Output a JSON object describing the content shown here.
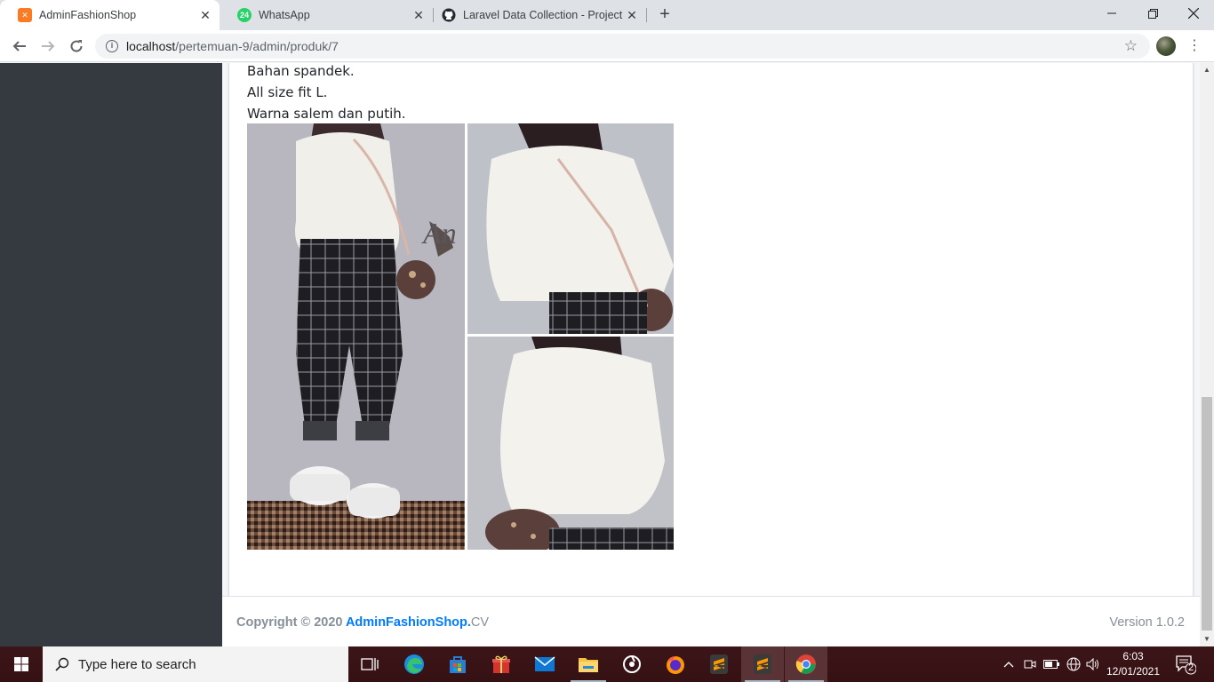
{
  "browser": {
    "tabs": [
      {
        "title": "AdminFashionShop",
        "active": true,
        "favicon": "xampp-icon"
      },
      {
        "title": "WhatsApp",
        "active": false,
        "favicon": "whatsapp-icon",
        "badge": "24"
      },
      {
        "title": "Laravel Data Collection - Project",
        "active": false,
        "favicon": "github-icon"
      }
    ],
    "new_tab_label": "+",
    "url_host": "localhost",
    "url_path": "/pertemuan-9/admin/produk/7"
  },
  "product": {
    "description_lines": [
      "Bahan spandek.",
      "All size fit L.",
      "Warna salem dan putih."
    ]
  },
  "footer": {
    "copyright_prefix": "Copyright © 2020 ",
    "brand": "AdminFashionShop.",
    "brand_suffix": "CV",
    "version": "Version 1.0.2"
  },
  "taskbar": {
    "search_placeholder": "Type here to search",
    "time": "6:03",
    "date": "12/01/2021",
    "notification_count": "2"
  },
  "colors": {
    "sidebar": "#343a40",
    "link": "#007bff",
    "taskbar": "#3a1216"
  }
}
